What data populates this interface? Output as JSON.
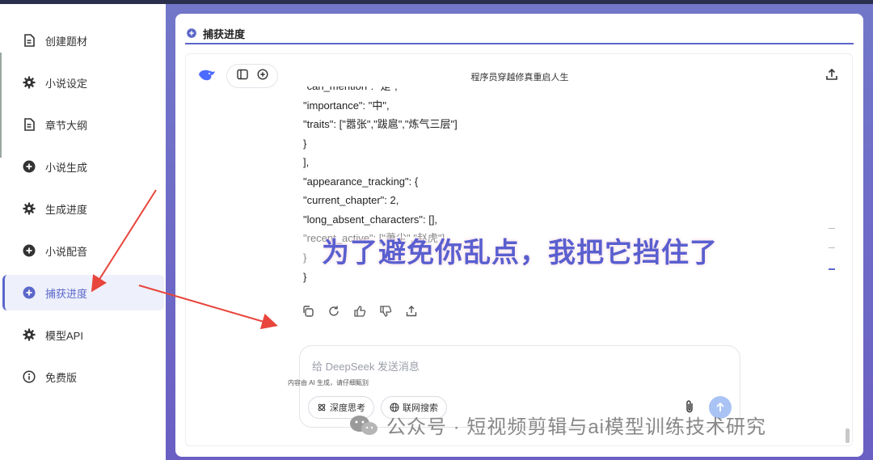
{
  "sidebar": {
    "items": [
      {
        "label": "创建题材",
        "icon": "document-icon",
        "active": false
      },
      {
        "label": "小说设定",
        "icon": "gear-icon",
        "active": false
      },
      {
        "label": "章节大纲",
        "icon": "document-icon",
        "active": false
      },
      {
        "label": "小说生成",
        "icon": "plus-circle-icon",
        "active": false
      },
      {
        "label": "生成进度",
        "icon": "gear-icon",
        "active": false
      },
      {
        "label": "小说配音",
        "icon": "plus-circle-icon",
        "active": false
      },
      {
        "label": "捕获进度",
        "icon": "plus-circle-icon",
        "active": true
      },
      {
        "label": "模型API",
        "icon": "gear-icon",
        "active": false
      },
      {
        "label": "免费版",
        "icon": "info-circle-icon",
        "active": false
      }
    ]
  },
  "panel": {
    "title": "捕获进度"
  },
  "chat": {
    "title": "程序员穿越修真重启人生",
    "code_lines": [
      "\"can_mention\": \"是\",",
      "\"importance\": \"中\",",
      "\"traits\": [\"嚣张\",\"跋扈\",\"炼气三层\"]",
      "}",
      "],",
      "\"appearance_tracking\": {",
      "\"current_chapter\": 2,",
      "\"long_absent_characters\": [],",
      "\"recent_active\": [\"萧尘\",\"赵虎\"]",
      "}",
      "}"
    ],
    "overlay_text": "为了避免你乱点，我把它挡住了",
    "input_placeholder": "给 DeepSeek 发送消息",
    "chip_deep_think": "深度思考",
    "chip_web_search": "联网搜索",
    "footnote": "内容由 AI 生成，请仔细甄别"
  },
  "watermark": {
    "text": "公众号 · 短视频剪辑与ai模型训练技术研究"
  },
  "colors": {
    "accent": "#5b67c9",
    "main_bg": "#6e6ac6",
    "arrow": "#e8453c",
    "overlay_text": "#5a5fcf"
  }
}
